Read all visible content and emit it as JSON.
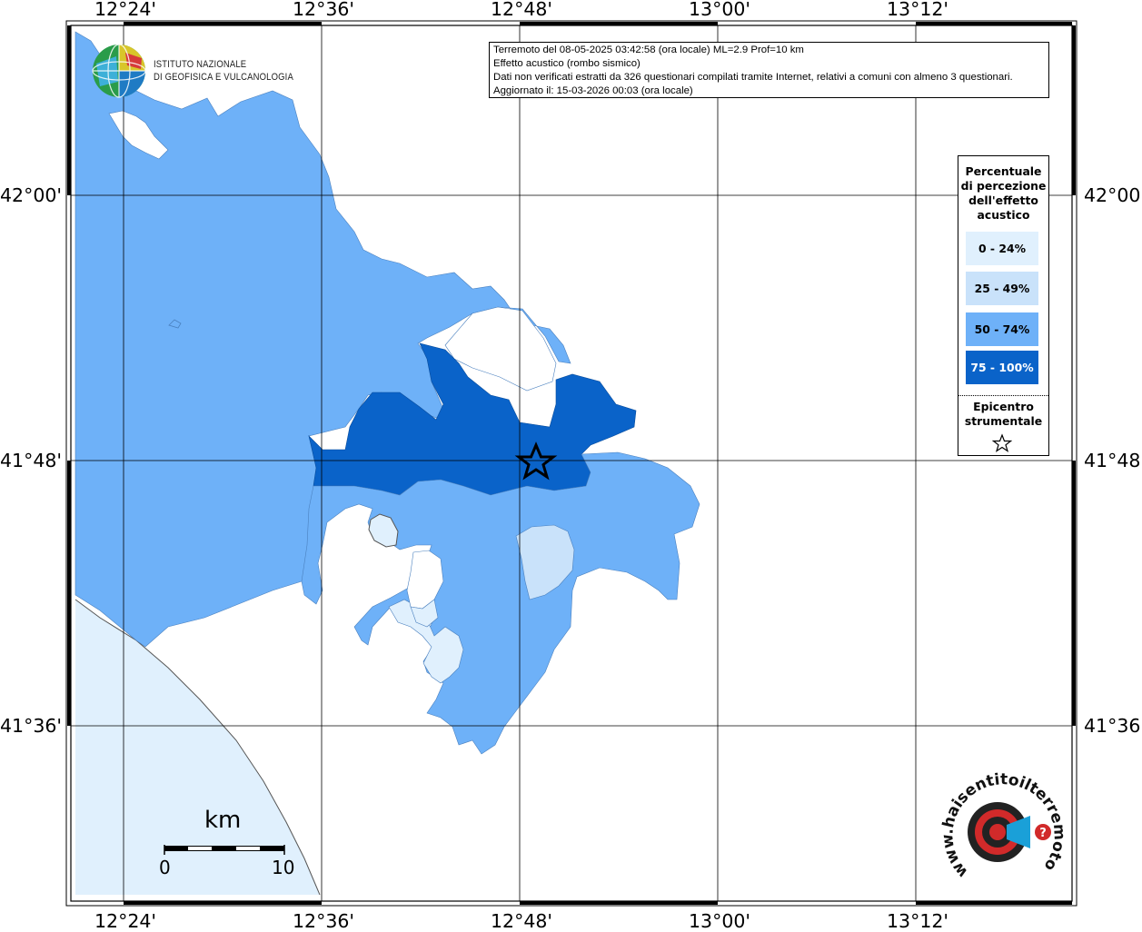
{
  "info": {
    "line1": "Terremoto del 08-05-2025 03:42:58 (ora locale) ML=2.9 Prof=10 km",
    "line2": "Effetto acustico (rombo sismico)",
    "line3": "Dati non verificati estratti da 326 questionari compilati tramite Internet, relativi a comuni con almeno 3 questionari.",
    "line4": "Aggiornato il: 15-03-2026 00:03 (ora locale)"
  },
  "logo": {
    "line1": "ISTITUTO NAZIONALE",
    "line2": "DI GEOFISICA E VULCANOLOGIA"
  },
  "axes": {
    "lon_labels": [
      "12°24'",
      "12°36'",
      "12°48'",
      "13°00'",
      "13°12'"
    ],
    "lat_labels": [
      "42°00'",
      "41°48'",
      "41°36'"
    ]
  },
  "legend": {
    "title_lines": [
      "Percentuale",
      "di percezione",
      "dell'effetto",
      "acustico"
    ],
    "classes": [
      {
        "label": "0 - 24%",
        "color": "#e0f0fd",
        "text_color": "#000000"
      },
      {
        "label": "25 - 49%",
        "color": "#c9e2fa",
        "text_color": "#000000"
      },
      {
        "label": "50 - 74%",
        "color": "#6eb1f8",
        "text_color": "#000000"
      },
      {
        "label": "75 - 100%",
        "color": "#0a63c9",
        "text_color": "#ffffff"
      }
    ],
    "epicenter_lines": [
      "Epicentro",
      "strumentale"
    ]
  },
  "scalebar": {
    "unit": "km",
    "start": "0",
    "end": "10"
  },
  "badge": {
    "text": "www.haisentitoilterremoto.it",
    "icon": "ear-target-icon"
  },
  "colors": {
    "sea": "#e0f0fd",
    "land_unknown": "#ffffff",
    "frame": "#000000"
  }
}
